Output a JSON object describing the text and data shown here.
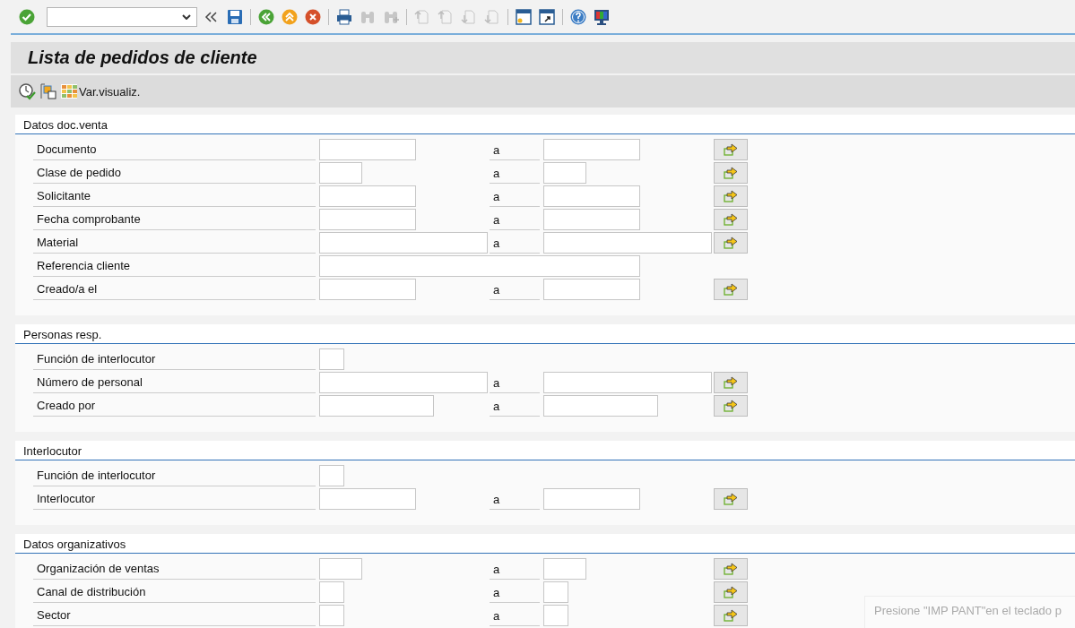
{
  "toolbar": [
    {
      "kind": "check",
      "disabled": false
    },
    {
      "kind": "command-field"
    },
    {
      "kind": "chevrons",
      "disabled": false
    },
    {
      "kind": "save",
      "disabled": false
    },
    {
      "kind": "sep"
    },
    {
      "kind": "back",
      "disabled": false
    },
    {
      "kind": "exit",
      "disabled": false
    },
    {
      "kind": "cancel",
      "disabled": false
    },
    {
      "kind": "sep"
    },
    {
      "kind": "print",
      "disabled": false
    },
    {
      "kind": "find",
      "disabled": true
    },
    {
      "kind": "find-next",
      "disabled": true
    },
    {
      "kind": "sep"
    },
    {
      "kind": "first-page",
      "disabled": true
    },
    {
      "kind": "prev-page",
      "disabled": true
    },
    {
      "kind": "next-page",
      "disabled": true
    },
    {
      "kind": "last-page",
      "disabled": true
    },
    {
      "kind": "sep"
    },
    {
      "kind": "new-window",
      "disabled": false
    },
    {
      "kind": "shortcut",
      "disabled": false
    },
    {
      "kind": "sep"
    },
    {
      "kind": "help",
      "disabled": false
    },
    {
      "kind": "layout",
      "disabled": false
    }
  ],
  "title": "Lista de pedidos de cliente",
  "app_toolbar": [
    {
      "kind": "execute"
    },
    {
      "kind": "variant"
    },
    {
      "kind": "layout-grid",
      "label": "Var.visualiz."
    }
  ],
  "sections": [
    {
      "title": "Datos doc.venta",
      "rows": [
        {
          "label": "Documento",
          "from_field": {
            "kind": "medium"
          },
          "to_label": "a",
          "to_field": {
            "kind": "medium"
          },
          "more_button": true
        },
        {
          "label": "Clase de pedido",
          "from_field": {
            "kind": "short"
          },
          "to_label": "a",
          "to_field": {
            "kind": "short"
          },
          "more_button": true
        },
        {
          "label": "Solicitante",
          "from_field": {
            "kind": "medium"
          },
          "to_label": "a",
          "to_field": {
            "kind": "medium"
          },
          "more_button": true
        },
        {
          "label": "Fecha comprobante",
          "from_field": {
            "kind": "medium"
          },
          "to_label": "a",
          "to_field": {
            "kind": "medium"
          },
          "more_button": true
        },
        {
          "label": "Material",
          "from_field": {
            "kind": "wide"
          },
          "to_label": "a",
          "to_field": {
            "kind": "wide"
          },
          "more_button": true
        },
        {
          "label": "Referencia cliente",
          "from_field": {
            "kind": "full"
          },
          "more_button": false
        },
        {
          "label": "Creado/a el",
          "from_field": {
            "kind": "medium"
          },
          "to_label": "a",
          "to_field": {
            "kind": "medium"
          },
          "more_button": true
        }
      ]
    },
    {
      "title": "Personas resp.",
      "rows": [
        {
          "label": "Función de interlocutor",
          "from_field": {
            "kind": "tiny"
          },
          "more_button": false
        },
        {
          "label": "Número de personal",
          "from_field": {
            "kind": "wide"
          },
          "to_label": "a",
          "to_field": {
            "kind": "wide"
          },
          "more_button": true
        },
        {
          "label": "Creado por",
          "from_field": {
            "kind": "long"
          },
          "to_label": "a",
          "to_field": {
            "kind": "long"
          },
          "more_button": true
        }
      ]
    },
    {
      "title": "Interlocutor",
      "rows": [
        {
          "label": "Función de interlocutor",
          "from_field": {
            "kind": "tiny"
          },
          "more_button": false
        },
        {
          "label": "Interlocutor",
          "from_field": {
            "kind": "medium"
          },
          "to_label": "a",
          "to_field": {
            "kind": "medium"
          },
          "more_button": true
        }
      ]
    },
    {
      "title": "Datos organizativos",
      "rows": [
        {
          "label": "Organización de ventas",
          "from_field": {
            "kind": "short"
          },
          "to_label": "a",
          "to_field": {
            "kind": "short"
          },
          "more_button": true
        },
        {
          "label": "Canal de distribución",
          "from_field": {
            "kind": "tiny"
          },
          "to_label": "a",
          "to_field": {
            "kind": "tiny"
          },
          "more_button": true
        },
        {
          "label": "Sector",
          "from_field": {
            "kind": "tiny"
          },
          "to_label": "a",
          "to_field": {
            "kind": "tiny"
          },
          "more_button": true
        }
      ]
    }
  ],
  "notification": {
    "text": "Presione \"IMP PANT\"en el teclado p"
  }
}
